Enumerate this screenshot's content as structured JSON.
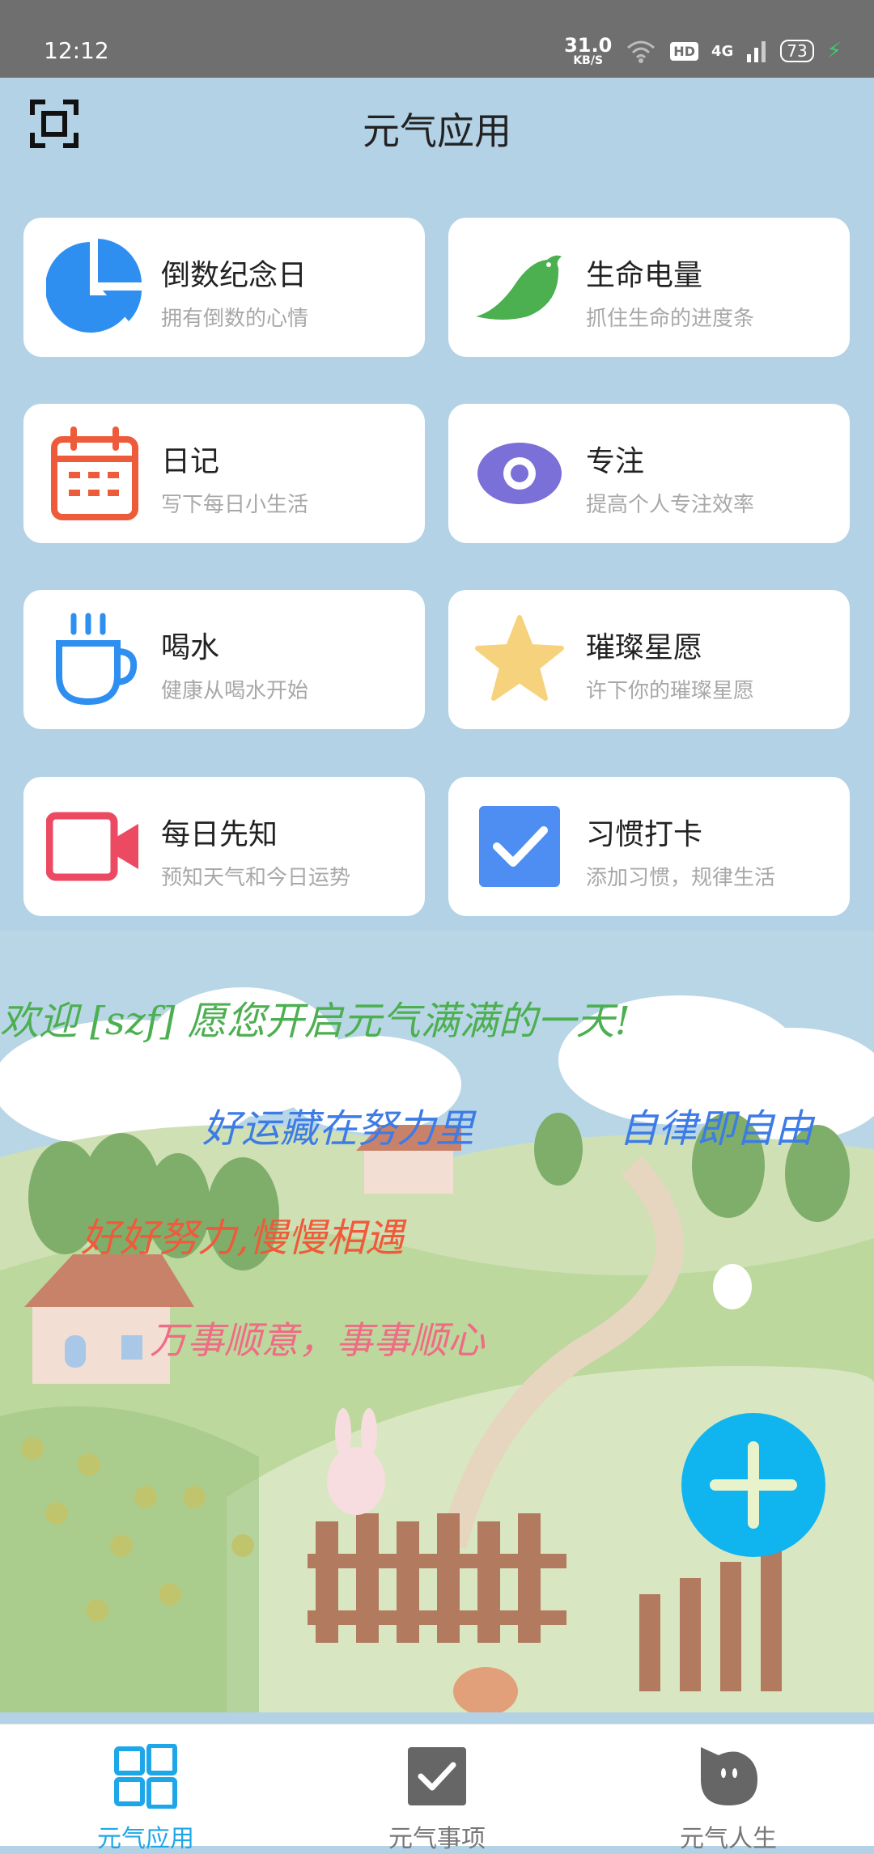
{
  "status": {
    "time": "12:12",
    "speed_value": "31.0",
    "speed_unit": "KB/S",
    "hd": "HD",
    "network": "4G",
    "battery": "73"
  },
  "header": {
    "title": "元气应用"
  },
  "cards": [
    {
      "title": "倒数纪念日",
      "subtitle": "拥有倒数的心情",
      "icon": "pie-chart-icon",
      "color": "#2e8ff0"
    },
    {
      "title": "生命电量",
      "subtitle": "抓住生命的进度条",
      "icon": "bird-icon",
      "color": "#4caf50"
    },
    {
      "title": "日记",
      "subtitle": "写下每日小生活",
      "icon": "calendar-icon",
      "color": "#ee5b3a"
    },
    {
      "title": "专注",
      "subtitle": "提高个人专注效率",
      "icon": "eye-icon",
      "color": "#7b6fd8"
    },
    {
      "title": "喝水",
      "subtitle": "健康从喝水开始",
      "icon": "cup-icon",
      "color": "#2e8ff0"
    },
    {
      "title": "璀璨星愿",
      "subtitle": "许下你的璀璨星愿",
      "icon": "star-icon",
      "color": "#f7d27c"
    },
    {
      "title": "每日先知",
      "subtitle": "预知天气和今日运势",
      "icon": "video-camera-icon",
      "color": "#ec4a63"
    },
    {
      "title": "习惯打卡",
      "subtitle": "添加习惯，规律生活",
      "icon": "checkbox-icon",
      "color": "#4e8ef2"
    }
  ],
  "slogans": {
    "welcome": "欢迎 [szf] 愿您开启元气满满的一天!",
    "luck": "好运藏在努力里",
    "discipline": "自律即自由",
    "effort": "好好努力,慢慢相遇",
    "wish": "万事顺意，事事顺心",
    "colors": {
      "welcome": "#4caf50",
      "luck": "#3d7be6",
      "effort": "#f05a3a",
      "wish": "#ef6b86"
    }
  },
  "bottom_nav": [
    {
      "label": "元气应用",
      "icon": "grid-icon",
      "active": true
    },
    {
      "label": "元气事项",
      "icon": "checkbox-icon",
      "active": false
    },
    {
      "label": "元气人生",
      "icon": "face-icon",
      "active": false
    }
  ],
  "colors": {
    "accent": "#10b5ef",
    "background": "#b3d2e5"
  }
}
